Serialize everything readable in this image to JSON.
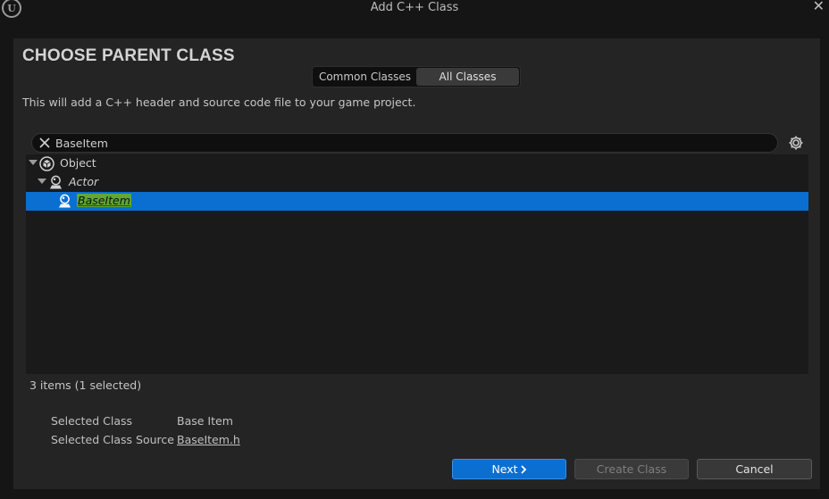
{
  "window": {
    "title": "Add C++ Class",
    "logo_icon": "unreal-engine-logo",
    "logo_text": "U",
    "close_glyph": "✕"
  },
  "header": {
    "title": "CHOOSE PARENT CLASS"
  },
  "tabs": [
    {
      "label": "Common Classes",
      "active": false
    },
    {
      "label": "All Classes",
      "active": true
    }
  ],
  "description": "This will add a C++ header and source code file to your game project.",
  "search": {
    "value": "BaseItem",
    "clear_icon": "close-icon"
  },
  "tree": {
    "items": [
      {
        "label": "Object",
        "icon": "object-class-icon",
        "italic": false,
        "expanded": true
      },
      {
        "label": "Actor",
        "icon": "actor-class-icon",
        "italic": true,
        "expanded": true
      },
      {
        "label": "BaseItem",
        "icon": "actor-class-icon",
        "italic": true,
        "selected": true
      }
    ]
  },
  "status": {
    "count_text": "3 items (1 selected)"
  },
  "selection": {
    "class_label": "Selected Class",
    "class_value": "Base Item",
    "source_label": "Selected Class Source",
    "source_value": "BaseItem.h"
  },
  "buttons": {
    "next": "Next",
    "create": "Create Class",
    "cancel": "Cancel"
  },
  "colors": {
    "accent": "#0a6fd1",
    "highlight": "#5fa836",
    "background": "#151515",
    "panel": "#242424"
  }
}
